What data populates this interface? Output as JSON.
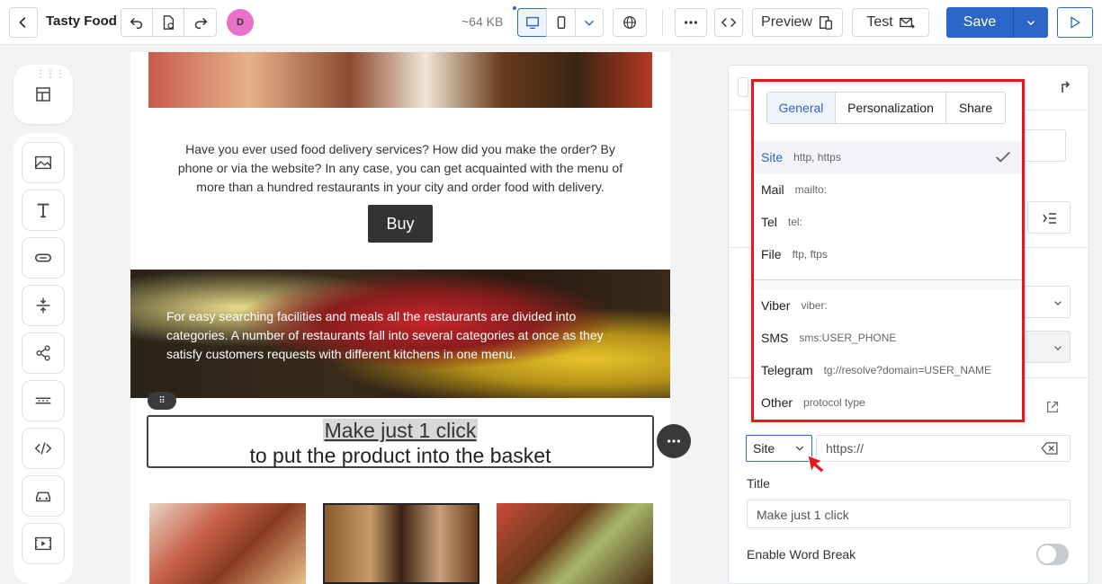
{
  "app": {
    "title": "Tasty Food",
    "avatar_initial": "D",
    "size": "~64 KB"
  },
  "toolbar": {
    "preview_label": "Preview",
    "test_label": "Test",
    "save_label": "Save"
  },
  "content": {
    "para1": "Have you ever used food delivery services? How did you make the order? By phone or via the website? In any case, you can get acquainted with the menu of more than a hundred restaurants in your city and order food with delivery.",
    "buy_label": "Buy",
    "para2": "For easy searching facilities and meals all the restaurants are divided into categories. A number of restaurants fall into several categories at once as they satisfy customers requests with different kitchens in one menu.",
    "text_line1": "Make just 1 click",
    "text_line2": "to put the product into the basket"
  },
  "dropdown": {
    "tabs": [
      {
        "label": "General",
        "active": true
      },
      {
        "label": "Personalization",
        "active": false
      },
      {
        "label": "Share",
        "active": false
      }
    ],
    "items": [
      {
        "name": "Site",
        "proto": "http, https",
        "selected": true
      },
      {
        "name": "Mail",
        "proto": "mailto:"
      },
      {
        "name": "Tel",
        "proto": "tel:"
      },
      {
        "name": "File",
        "proto": "ftp, ftps"
      },
      {
        "name": "Viber",
        "proto": "viber:"
      },
      {
        "name": "SMS",
        "proto": "sms:USER_PHONE"
      },
      {
        "name": "Telegram",
        "proto": "tg://resolve?domain=USER_NAME"
      },
      {
        "name": "Other",
        "proto": "protocol type"
      }
    ]
  },
  "link": {
    "type_value": "Site",
    "url_placeholder": "https://",
    "title_label": "Title",
    "title_placeholder": "Make just 1 click",
    "word_break_label": "Enable Word Break",
    "word_break_on": false
  },
  "colors": {
    "accent": "#2b66c8",
    "highlight_border": "#e8161b",
    "avatar": "#e872c9"
  }
}
